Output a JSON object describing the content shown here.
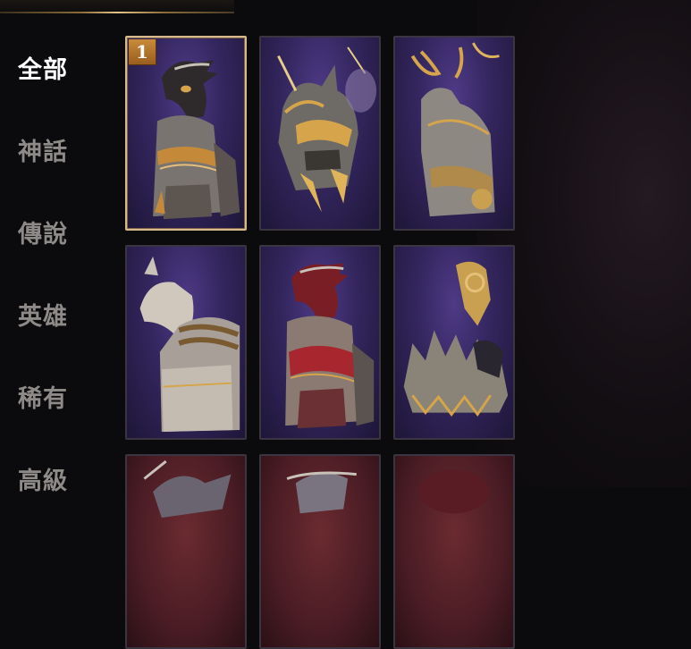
{
  "sidebar": {
    "categories": [
      {
        "label": "全部",
        "active": true
      },
      {
        "label": "神話"
      },
      {
        "label": "傳說"
      },
      {
        "label": "英雄"
      },
      {
        "label": "稀有"
      },
      {
        "label": "高級"
      }
    ]
  },
  "grid": {
    "items": [
      {
        "name": "armored-dragon-mount",
        "badge": "1",
        "selected": true
      },
      {
        "name": "golden-wolf-mount"
      },
      {
        "name": "golden-antler-wolf-mount"
      },
      {
        "name": "silver-horse-mount"
      },
      {
        "name": "crimson-dragon-mount"
      },
      {
        "name": "spiked-beast-mount"
      },
      {
        "name": "mount-partial-1"
      },
      {
        "name": "mount-partial-2"
      },
      {
        "name": "mount-partial-3"
      }
    ]
  },
  "colors": {
    "active_text": "#ffffff",
    "inactive_text": "#8d8a88",
    "card_bg_purple": "#3a2a6e",
    "card_bg_red": "#4a1c24",
    "selected_border": "#d8b98e",
    "badge": "#b5742c",
    "gold": "#d6a44a"
  }
}
